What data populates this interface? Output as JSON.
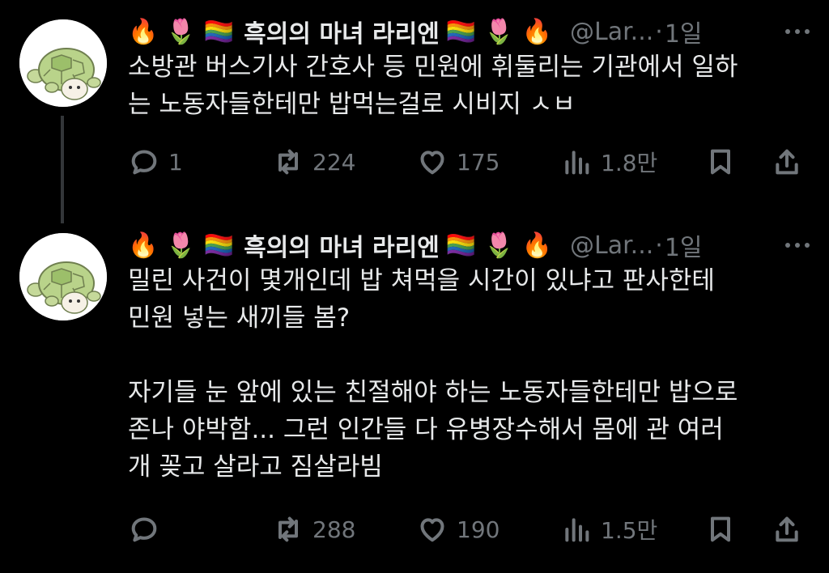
{
  "tweets": [
    {
      "display_name_emoji_left": "🔥 🌷 🏳️‍🌈",
      "display_name": "흑의의 마녀 라리엔",
      "display_name_emoji_right": "🏳️‍🌈 🌷 🔥",
      "handle": "@Lar...",
      "dot": "·",
      "time": "1일",
      "lines": [
        "소방관 버스기사 간호사 등 민원에 휘둘리는 기관에서 일하",
        "는 노동자들한테만 밥먹는걸로 시비지 ㅅㅂ"
      ],
      "replies": "1",
      "retweets": "224",
      "likes": "175",
      "views": "1.8만"
    },
    {
      "display_name_emoji_left": "🔥 🌷 🏳️‍🌈",
      "display_name": "흑의의 마녀 라리엔",
      "display_name_emoji_right": "🏳️‍🌈 🌷 🔥",
      "handle": "@Lar...",
      "dot": "·",
      "time": "1일",
      "lines_a": [
        "밀린 사건이 몇개인데 밥 쳐먹을 시간이 있냐고 판사한테",
        "민원 넣는 새끼들 봄?"
      ],
      "lines_b": [
        "자기들 눈 앞에 있는 친절해야 하는 노동자들한테만 밥으로",
        "존나 야박함... 그런 인간들 다 유병장수해서 몸에 관 여러",
        "개 꽂고 살라고 짐살라빔"
      ],
      "replies": "",
      "retweets": "288",
      "likes": "190",
      "views": "1.5만"
    }
  ],
  "colors": {
    "background": "#000000",
    "text": "#e7e9ea",
    "muted": "#71767b",
    "thread_line": "#333639"
  },
  "icons": [
    "reply-icon",
    "retweet-icon",
    "like-icon",
    "views-icon",
    "bookmark-icon",
    "share-icon",
    "more-icon"
  ]
}
